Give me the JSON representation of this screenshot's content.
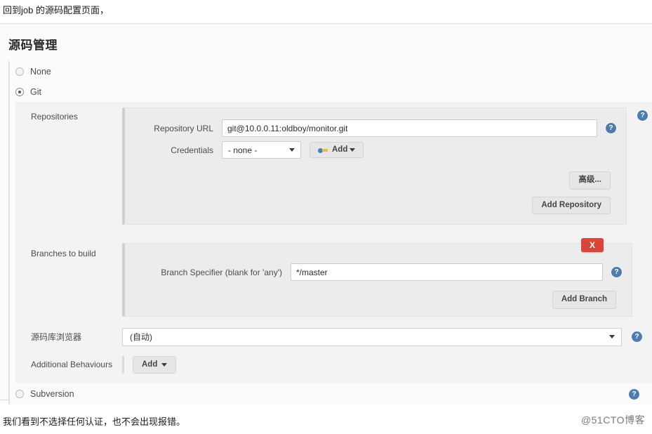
{
  "top_caption": "回到job 的源码配置页面，",
  "section": {
    "title": "源码管理",
    "scm_options": [
      {
        "label": "None",
        "selected": false
      },
      {
        "label": "Git",
        "selected": true
      },
      {
        "label": "Subversion",
        "selected": false
      }
    ]
  },
  "repositories": {
    "label": "Repositories",
    "repository_url": {
      "label": "Repository URL",
      "value": "git@10.0.0.11:oldboy/monitor.git",
      "help_icon": "help-icon"
    },
    "credentials": {
      "label": "Credentials",
      "selected": "- none -",
      "options": [
        "- none -"
      ],
      "add_button": {
        "label": "Add",
        "icon": "key-icon",
        "caret": "chevron-down-icon"
      }
    },
    "advanced_button": "高级...",
    "add_repository_button": "Add Repository",
    "help_icon": "help-icon"
  },
  "branches": {
    "label": "Branches to build",
    "delete_button": "X",
    "branch_specifier": {
      "label": "Branch Specifier (blank for 'any')",
      "value": "*/master",
      "help_icon": "help-icon"
    },
    "add_branch_button": "Add Branch"
  },
  "repository_browser": {
    "label": "源码库浏览器",
    "selected": "(自动)",
    "options": [
      "(自动)"
    ],
    "help_icon": "help-icon"
  },
  "additional_behaviours": {
    "label": "Additional Behaviours",
    "add_button": "Add",
    "caret": "chevron-down-icon"
  },
  "subversion": {
    "label": "Subversion",
    "help_icon": "help-icon"
  },
  "bottom_caption": "我们看到不选择任何认证，也不会出现报错。",
  "watermark": "@51CTO博客",
  "colors": {
    "panel_bg": "#fbfbfb",
    "card_bg": "#ececec",
    "help_blue": "#4f7cb0",
    "delete_red": "#d9453b",
    "button_gray": "#e6e6e6"
  }
}
